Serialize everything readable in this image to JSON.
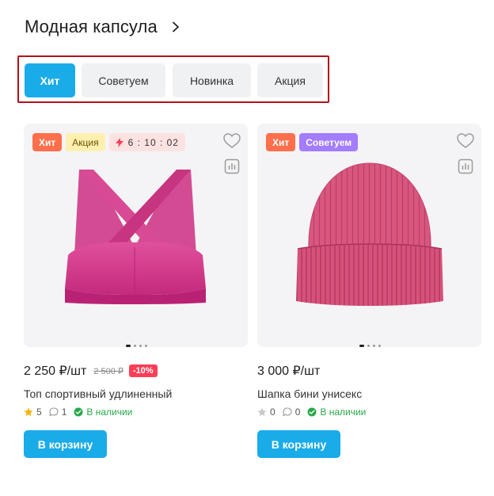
{
  "section": {
    "title": "Модная капсула"
  },
  "filters": [
    {
      "label": "Хит",
      "active": true
    },
    {
      "label": "Советуем",
      "active": false
    },
    {
      "label": "Новинка",
      "active": false
    },
    {
      "label": "Акция",
      "active": false
    }
  ],
  "products": [
    {
      "badges": {
        "hit": "Хит",
        "promo": "Акция",
        "timer": "6 : 10 : 02"
      },
      "price": "2 250 ₽/шт",
      "old_price": "2 500 ₽",
      "discount": "-10%",
      "name": "Топ спортивный удлиненный",
      "rating": "5",
      "reviews": "1",
      "stock": "В наличии",
      "cart_label": "В корзину",
      "rated": true,
      "image": "pink-sports-bra"
    },
    {
      "badges": {
        "hit": "Хит",
        "recommend": "Советуем"
      },
      "price": "3 000 ₽/шт",
      "name": "Шапка бини унисекс",
      "rating": "0",
      "reviews": "0",
      "stock": "В наличии",
      "cart_label": "В корзину",
      "rated": false,
      "image": "pink-beanie-hat"
    }
  ],
  "colors": {
    "accent": "#1aabe9",
    "hit": "#ff6f4c",
    "recommend": "#a37cff",
    "discount": "#ff3d57",
    "in_stock": "#27a84a",
    "star": "#f5b301"
  }
}
